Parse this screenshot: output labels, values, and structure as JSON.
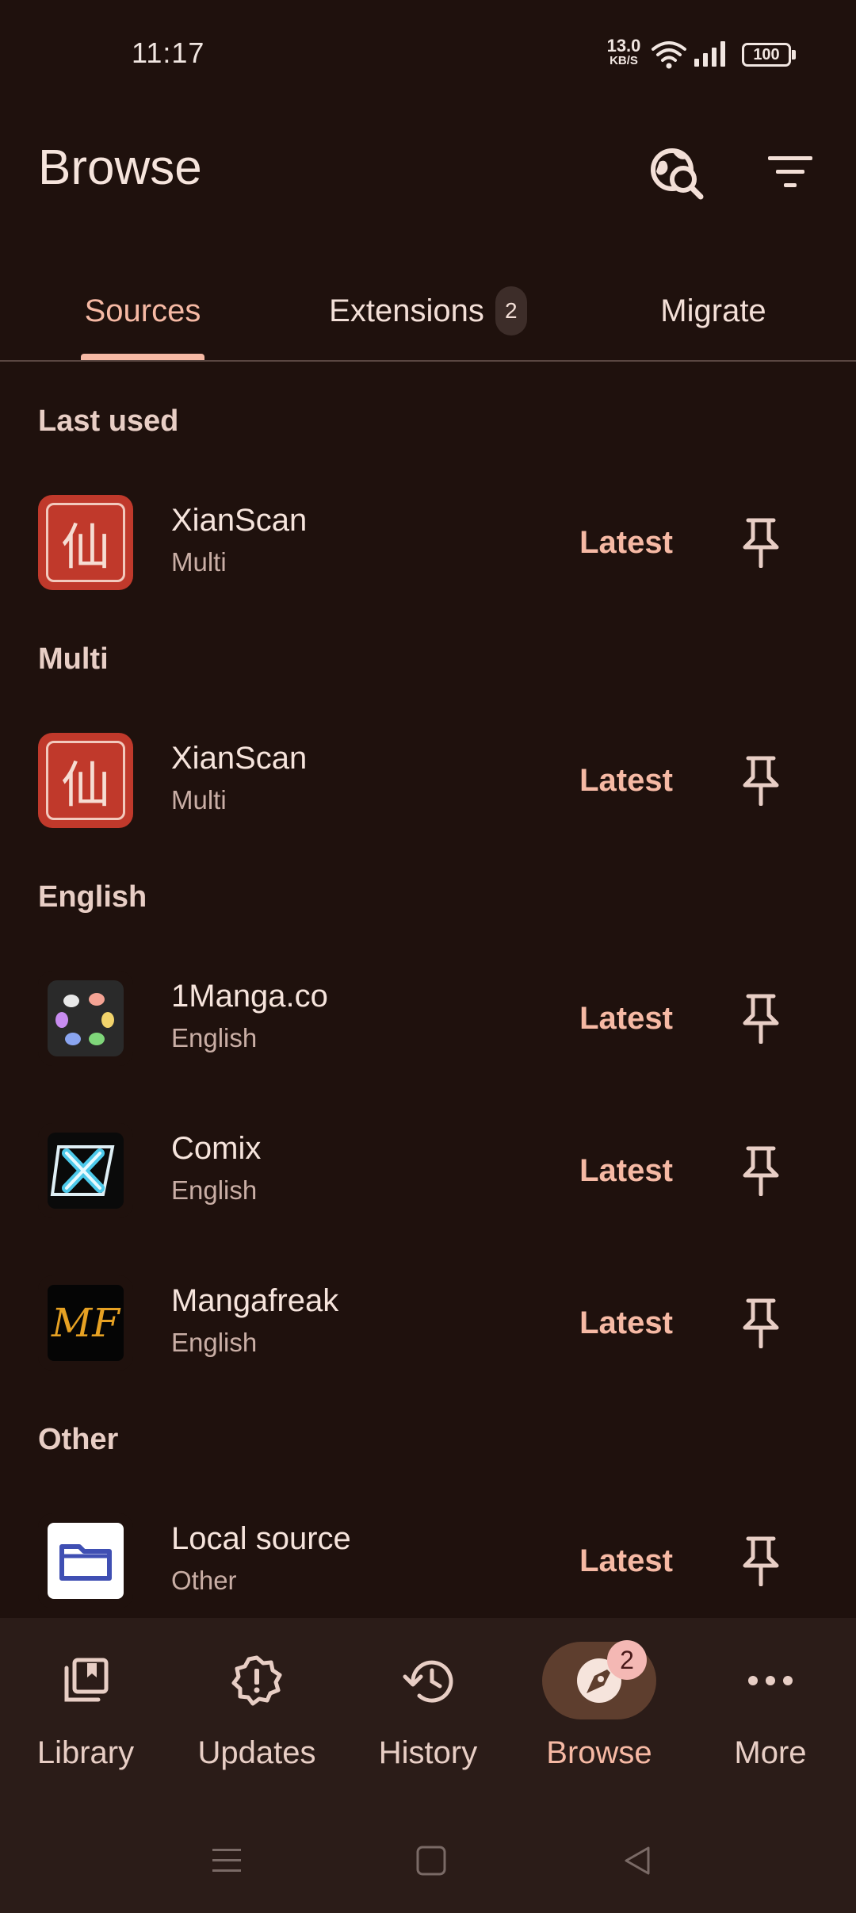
{
  "status_bar": {
    "time": "11:17",
    "net_speed_value": "13.0",
    "net_speed_unit": "KB/S",
    "battery": "100"
  },
  "app_bar": {
    "title": "Browse",
    "global_search_icon": "travel-explore-icon",
    "filter_icon": "filter-list-icon"
  },
  "tabs": [
    {
      "label": "Sources",
      "selected": true
    },
    {
      "label": "Extensions",
      "badge": "2"
    },
    {
      "label": "Migrate"
    }
  ],
  "sections": {
    "last_used": "Last used",
    "multi": "Multi",
    "english": "English",
    "other": "Other"
  },
  "sources": {
    "last_used_xianscan": {
      "name": "XianScan",
      "lang": "Multi",
      "action": "Latest"
    },
    "multi_xianscan": {
      "name": "XianScan",
      "lang": "Multi",
      "action": "Latest"
    },
    "onemanga": {
      "name": "1Manga.co",
      "lang": "English",
      "action": "Latest"
    },
    "comix": {
      "name": "Comix",
      "lang": "English",
      "action": "Latest"
    },
    "mangafreak": {
      "name": "Mangafreak",
      "lang": "English",
      "action": "Latest",
      "logo_text": "MF"
    },
    "local": {
      "name": "Local source",
      "lang": "Other",
      "action": "Latest"
    }
  },
  "xianscan_logo_char": "仙",
  "bottom_nav": [
    {
      "label": "Library",
      "icon": "library-icon"
    },
    {
      "label": "Updates",
      "icon": "updates-icon"
    },
    {
      "label": "History",
      "icon": "history-icon"
    },
    {
      "label": "Browse",
      "icon": "browse-icon",
      "active": true,
      "badge": "2"
    },
    {
      "label": "More",
      "icon": "more-horiz-icon"
    }
  ],
  "colors": {
    "background": "#1f110d",
    "accent": "#f6b9a4",
    "nav_background": "#2b1c18",
    "active_pill": "#5e3e2e",
    "xianscan_red": "#c0392b"
  }
}
